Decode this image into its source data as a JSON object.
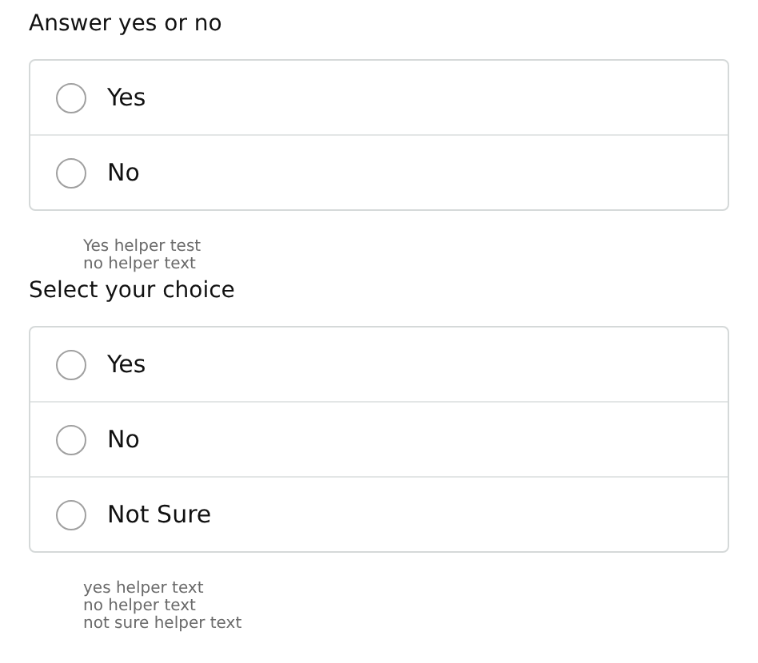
{
  "groups": [
    {
      "title": "Answer yes or no",
      "options": [
        {
          "label": "Yes",
          "selected": false
        },
        {
          "label": "No",
          "selected": false
        }
      ],
      "helpers": [
        "Yes helper test",
        "no helper text"
      ]
    },
    {
      "title": "Select your choice",
      "options": [
        {
          "label": "Yes",
          "selected": false
        },
        {
          "label": "No",
          "selected": false
        },
        {
          "label": "Not Sure",
          "selected": false
        }
      ],
      "helpers": [
        "yes helper text",
        "no helper text",
        "not sure helper text"
      ]
    }
  ]
}
